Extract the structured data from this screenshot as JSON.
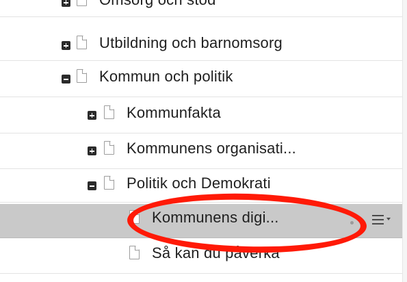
{
  "tree": {
    "items": [
      {
        "label": "Omsorg och stöd",
        "toggle": "plus"
      },
      {
        "label": "Utbildning och barnomsorg",
        "toggle": "plus"
      },
      {
        "label": "Kommun och politik",
        "toggle": "minus"
      },
      {
        "label": "Kommunfakta",
        "toggle": "plus"
      },
      {
        "label": "Kommunens organisati...",
        "toggle": "plus"
      },
      {
        "label": "Politik och Demokrati",
        "toggle": "minus"
      },
      {
        "label": "Kommunens digi...",
        "toggle": "none",
        "selected": true
      },
      {
        "label": "Så kan du påverka",
        "toggle": "none"
      }
    ]
  },
  "icons": {
    "expand": "plus-square-icon",
    "collapse": "minus-square-icon",
    "page": "document-icon",
    "row_menu": "hamburger-menu-icon"
  },
  "colors": {
    "selected_row": "#c9c9c9",
    "highlight": "#ff1a07",
    "toggle": "#2b2b2b"
  }
}
